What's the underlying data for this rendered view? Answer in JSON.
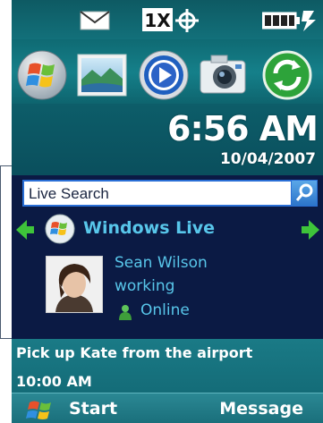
{
  "status_bar": {
    "icons": [
      "envelope-icon",
      "1x-signal-icon",
      "gps-icon",
      "battery-charging-icon"
    ],
    "network_label": "1X"
  },
  "launcher": {
    "apps": [
      "windows-start-icon",
      "pictures-icon",
      "media-player-icon",
      "camera-icon",
      "sync-icon"
    ]
  },
  "clock": {
    "time": "6:56 AM",
    "date": "10/04/2007"
  },
  "live_search": {
    "placeholder": "Live Search"
  },
  "windows_live": {
    "title": "Windows Live",
    "contact": {
      "name": "Sean Wilson",
      "status": "working",
      "presence": "Online"
    }
  },
  "appointment": {
    "title": "Pick up Kate from the airport",
    "time": "10:00 AM"
  },
  "softkeys": {
    "left": "Start",
    "right": "Message"
  },
  "colors": {
    "accent_text": "#58c6ea",
    "panel_dark": "#0b1a44",
    "teal": "#16636f",
    "arrow_green": "#3ec43a"
  }
}
